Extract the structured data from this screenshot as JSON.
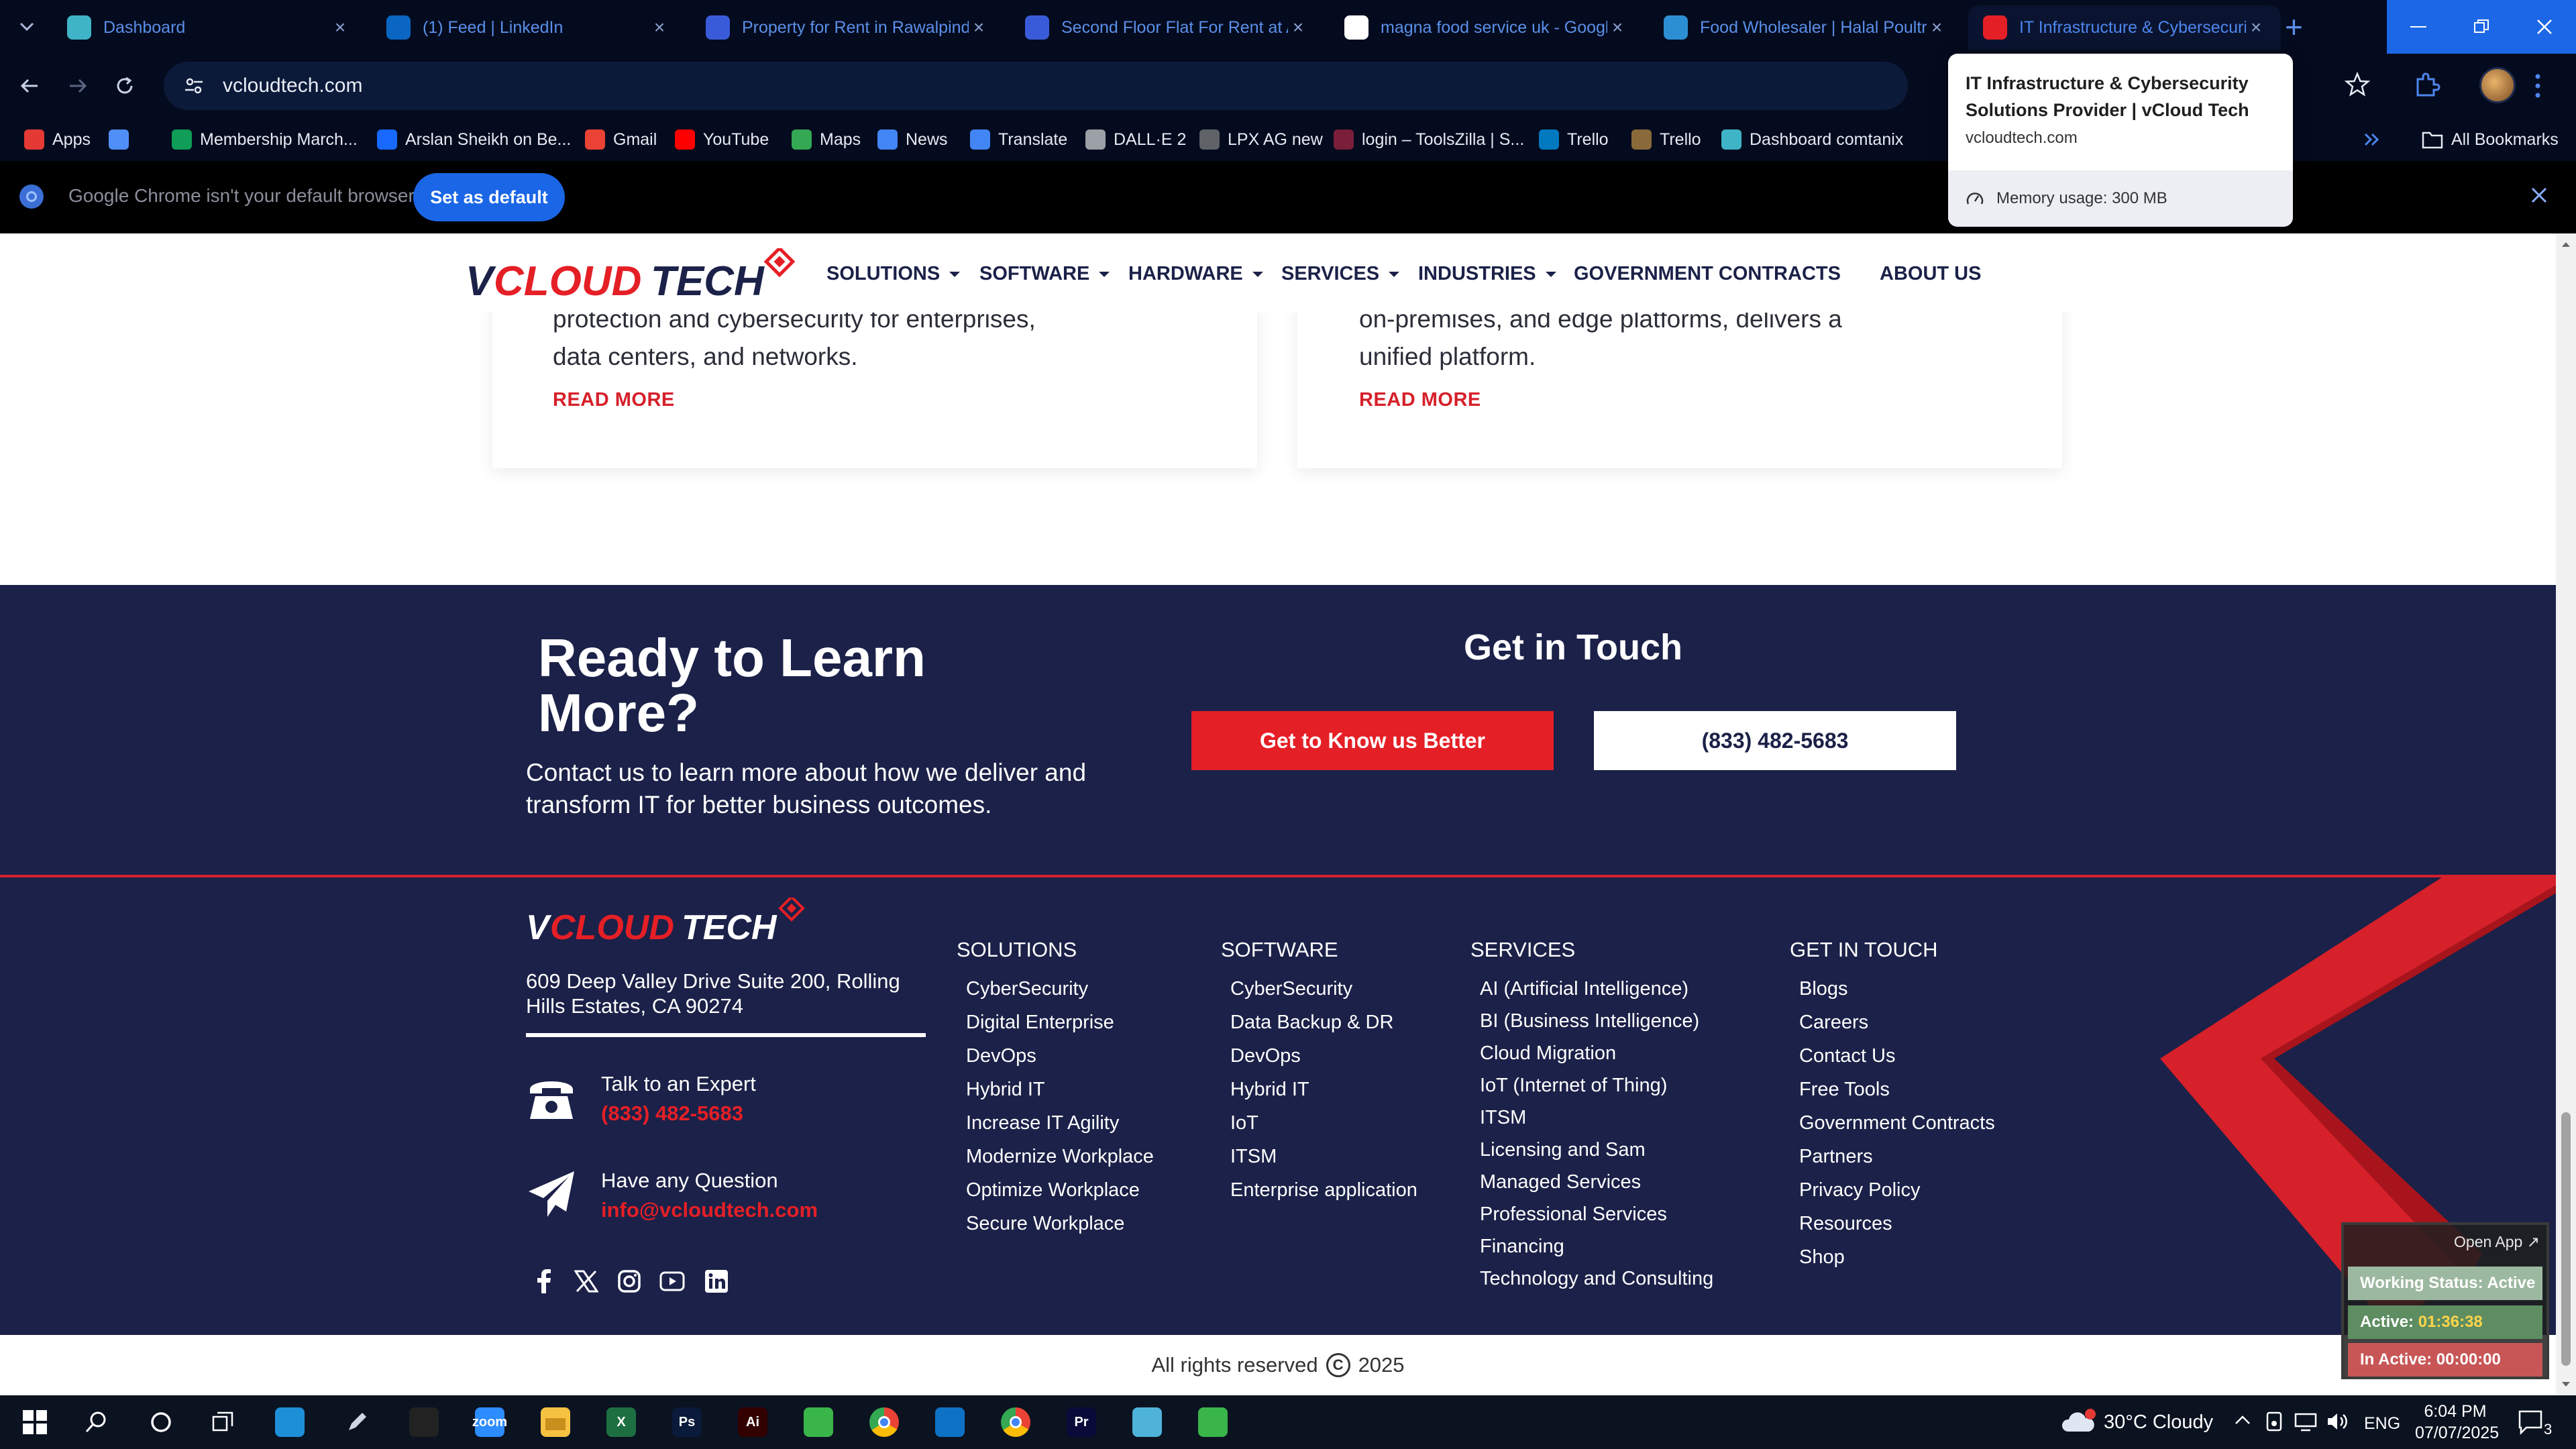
{
  "browser": {
    "tabs": [
      {
        "title": "Dashboard",
        "favicon": "dashboard-icon",
        "color": "#3fb4c7"
      },
      {
        "title": "(1) Feed | LinkedIn",
        "favicon": "linkedin-icon",
        "color": "#0a66c2"
      },
      {
        "title": "Property for Rent in Rawalpindi",
        "favicon": "property-icon",
        "color": "#3a5bd9"
      },
      {
        "title": "Second Floor Flat For Rent at A",
        "favicon": "property-icon",
        "color": "#3a5bd9"
      },
      {
        "title": "magna food service uk - Googl",
        "favicon": "google-icon",
        "color": "#ffffff"
      },
      {
        "title": "Food Wholesaler | Halal Poultry",
        "favicon": "m-icon",
        "color": "#2d8fd3"
      },
      {
        "title": "IT Infrastructure & Cybersecurity",
        "favicon": "vcloud-icon",
        "color": "#e51f26"
      }
    ],
    "url": "vcloudtech.com",
    "bookmarks": [
      {
        "label": "Apps",
        "icon": "apps-icon",
        "color": "#e53935"
      },
      {
        "label": "",
        "icon": "grid-icon",
        "color": "#4f8ff7"
      },
      {
        "label": "Membership March...",
        "icon": "sheets-icon",
        "color": "#0f9d58"
      },
      {
        "label": "Arslan Sheikh on Be...",
        "icon": "behance-icon",
        "color": "#1769ff"
      },
      {
        "label": "Gmail",
        "icon": "gmail-icon",
        "color": "#ea4335"
      },
      {
        "label": "YouTube",
        "icon": "youtube-icon",
        "color": "#ff0000"
      },
      {
        "label": "Maps",
        "icon": "maps-icon",
        "color": "#34a853"
      },
      {
        "label": "News",
        "icon": "news-icon",
        "color": "#4285f4"
      },
      {
        "label": "Translate",
        "icon": "translate-icon",
        "color": "#4285f4"
      },
      {
        "label": "DALL·E 2",
        "icon": "openai-icon",
        "color": "#9aa0a6"
      },
      {
        "label": "LPX AG new",
        "icon": "dash-icon",
        "color": "#5f6368"
      },
      {
        "label": "login – ToolsZilla | S...",
        "icon": "toolszilla-icon",
        "color": "#7b1e3a"
      },
      {
        "label": "Trello",
        "icon": "trello-icon",
        "color": "#0079bf"
      },
      {
        "label": "Trello",
        "icon": "trello-icon",
        "color": "#8a6a3a"
      },
      {
        "label": "Dashboard comtanix",
        "icon": "dashboard-icon",
        "color": "#3fb4c7"
      }
    ],
    "all_bookmarks": "All Bookmarks",
    "infobar_text": "Google Chrome isn't your default browser",
    "set_default": "Set as default",
    "hovercard": {
      "title": "IT Infrastructure & Cybersecurity Solutions Provider | vCloud Tech",
      "url": "vcloudtech.com",
      "memory": "Memory usage: 300 MB"
    }
  },
  "site": {
    "logo": "VCLOUD TECH",
    "nav": [
      {
        "label": "SOLUTIONS",
        "dropdown": true
      },
      {
        "label": "SOFTWARE",
        "dropdown": true
      },
      {
        "label": "HARDWARE",
        "dropdown": true
      },
      {
        "label": "SERVICES",
        "dropdown": true
      },
      {
        "label": "INDUSTRIES",
        "dropdown": true
      },
      {
        "label": "GOVERNMENT CONTRACTS",
        "dropdown": false
      },
      {
        "label": "ABOUT US",
        "dropdown": false
      }
    ],
    "cards": [
      {
        "line1": "protection and cybersecurity for enterprises,",
        "line2": "data centers, and networks.",
        "read_more": "READ MORE"
      },
      {
        "line1": "on-premises, and edge platforms, delivers a",
        "line2": "unified platform.",
        "read_more": "READ MORE"
      }
    ],
    "cta": {
      "title_line1": "Ready to Learn",
      "title_line2": "More?",
      "subtitle": "Contact us to learn more about how we deliver and transform IT for better business outcomes.",
      "get_in_touch": "Get in Touch",
      "btn_primary": "Get to Know us Better",
      "btn_phone": "(833) 482-5683"
    },
    "footer": {
      "address": "609 Deep Valley Drive Suite 200, Rolling Hills Estates, CA 90274",
      "talk_label": "Talk to an Expert",
      "talk_phone": "(833) 482-5683",
      "question_label": "Have any Question",
      "email": "info@vcloudtech.com",
      "socials": [
        "facebook-icon",
        "x-icon",
        "instagram-icon",
        "youtube-icon",
        "linkedin-icon"
      ],
      "columns": [
        {
          "heading": "SOLUTIONS",
          "items": [
            "CyberSecurity",
            "Digital Enterprise",
            "DevOps",
            "Hybrid IT",
            "Increase IT Agility",
            "Modernize Workplace",
            "Optimize Workplace",
            "Secure Workplace"
          ]
        },
        {
          "heading": "SOFTWARE",
          "items": [
            "CyberSecurity",
            "Data Backup & DR",
            "DevOps",
            "Hybrid IT",
            "IoT",
            "ITSM",
            "Enterprise application"
          ]
        },
        {
          "heading": "SERVICES",
          "items": [
            "AI (Artificial Intelligence)",
            "BI (Business Intelligence)",
            "Cloud Migration",
            "IoT (Internet of Thing)",
            "ITSM",
            "Licensing and Sam",
            "Managed Services",
            "Professional Services",
            "Financing",
            "Technology and Consulting"
          ]
        },
        {
          "heading": "GET IN TOUCH",
          "items": [
            "Blogs",
            "Careers",
            "Contact Us",
            "Free Tools",
            "Government Contracts",
            "Partners",
            "Privacy Policy",
            "Resources",
            "Shop"
          ]
        }
      ],
      "copyright_pre": "All rights reserved",
      "copyright_symbol": "C",
      "copyright_year": "2025"
    }
  },
  "tracker": {
    "open_app": "Open App ↗",
    "status": "Working Status: Active",
    "active_label": "Active:",
    "active_time": "01:36:38",
    "inactive": "In Active: 00:00:00"
  },
  "taskbar": {
    "apps": [
      {
        "name": "windows-start-icon"
      },
      {
        "name": "search-icon"
      },
      {
        "name": "cortana-icon"
      },
      {
        "name": "task-view-icon"
      },
      {
        "name": "edge-icon",
        "color": "#1d8fd6"
      },
      {
        "name": "pen-icon"
      },
      {
        "name": "terminal-icon",
        "color": "#222"
      },
      {
        "name": "zoom-icon",
        "color": "#2d8cff",
        "label": "zoom"
      },
      {
        "name": "file-explorer-icon",
        "color": "#f5c242"
      },
      {
        "name": "excel-icon",
        "color": "#1d6f42",
        "label": "X"
      },
      {
        "name": "photoshop-icon",
        "color": "#0a1a3a",
        "label": "Ps"
      },
      {
        "name": "illustrator-icon",
        "color": "#330000",
        "label": "Ai"
      },
      {
        "name": "green-app-icon",
        "color": "#39b54a"
      },
      {
        "name": "chrome-icon"
      },
      {
        "name": "vscode-icon",
        "color": "#0e72c4"
      },
      {
        "name": "chrome-icon"
      },
      {
        "name": "premiere-icon",
        "color": "#0a0a3a",
        "label": "Pr"
      },
      {
        "name": "kite-icon",
        "color": "#4fb3d9"
      },
      {
        "name": "green-app-icon",
        "color": "#39b54a"
      }
    ],
    "weather_temp": "30°C",
    "weather_desc": "Cloudy",
    "weather_badge": "1",
    "language": "ENG",
    "time": "6:04 PM",
    "date": "07/07/2025",
    "notifications": "3"
  }
}
